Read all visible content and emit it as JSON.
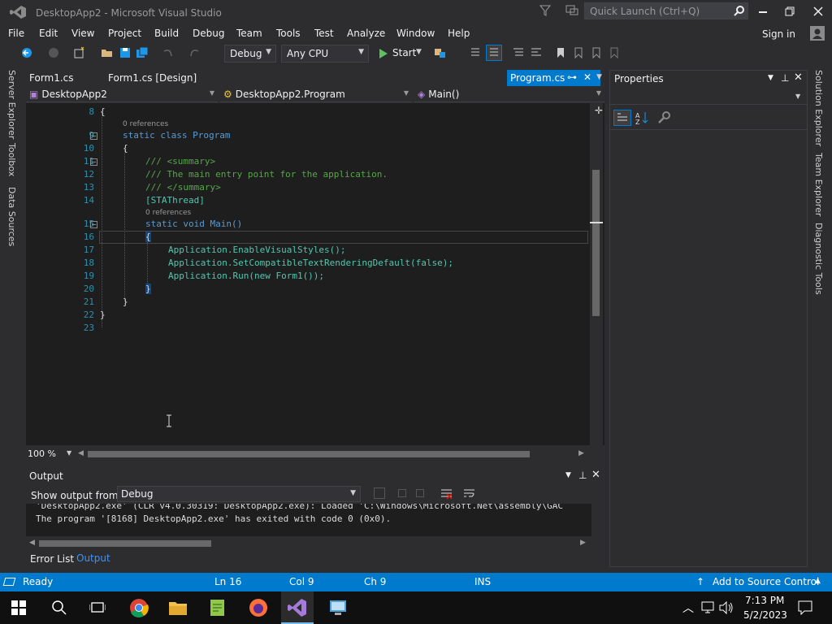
{
  "window": {
    "title": "DesktopApp2 - Microsoft Visual Studio",
    "quick_launch_placeholder": "Quick Launch (Ctrl+Q)",
    "sign_in": "Sign in"
  },
  "menu": [
    "File",
    "Edit",
    "View",
    "Project",
    "Build",
    "Debug",
    "Team",
    "Tools",
    "Test",
    "Analyze",
    "Window",
    "Help"
  ],
  "toolbar": {
    "config": "Debug",
    "platform": "Any CPU",
    "start": "Start"
  },
  "left_tabs": [
    "Server Explorer",
    "Toolbox",
    "Data Sources"
  ],
  "right_tabs": [
    "Solution Explorer",
    "Team Explorer",
    "Diagnostic Tools"
  ],
  "doc_tabs": [
    "Form1.cs",
    "Form1.cs [Design]",
    "Program.cs"
  ],
  "nav": {
    "project": "DesktopApp2",
    "class": "DesktopApp2.Program",
    "member": "Main()"
  },
  "editor": {
    "refs": "0 references",
    "lines": [
      {
        "n": "8",
        "text": "{"
      },
      {
        "n": "9",
        "text": "static class Program"
      },
      {
        "n": "10",
        "text": "{"
      },
      {
        "n": "11",
        "text": "/// <summary>"
      },
      {
        "n": "12",
        "text": "/// The main entry point for the application."
      },
      {
        "n": "13",
        "text": "/// </summary>"
      },
      {
        "n": "14",
        "text": "[STAThread]"
      },
      {
        "n": "15",
        "text": "static void Main()"
      },
      {
        "n": "16",
        "text": "{"
      },
      {
        "n": "17",
        "text": "Application.EnableVisualStyles();"
      },
      {
        "n": "18",
        "text": "Application.SetCompatibleTextRenderingDefault(false);"
      },
      {
        "n": "19",
        "text": "Application.Run(new Form1());"
      },
      {
        "n": "20",
        "text": "}"
      },
      {
        "n": "21",
        "text": "}"
      },
      {
        "n": "22",
        "text": "}"
      },
      {
        "n": "23",
        "text": ""
      }
    ],
    "zoom": "100 %"
  },
  "output": {
    "title": "Output",
    "show_from_label": "Show output from:",
    "source": "Debug",
    "line1": "'DesktopApp2.exe' (CLR v4.0.30319: DesktopApp2.exe): Loaded 'C:\\Windows\\Microsoft.Net\\assembly\\GAC",
    "line2": "The program '[8168] DesktopApp2.exe' has exited with code 0 (0x0).",
    "tab_error_list": "Error List",
    "tab_output": "Output"
  },
  "properties": {
    "title": "Properties"
  },
  "status": {
    "ready": "Ready",
    "ln": "Ln 16",
    "col": "Col 9",
    "ch": "Ch 9",
    "ins": "INS",
    "source_control": "Add to Source Control"
  },
  "taskbar": {
    "time": "7:13 PM",
    "date": "5/2/2023"
  }
}
